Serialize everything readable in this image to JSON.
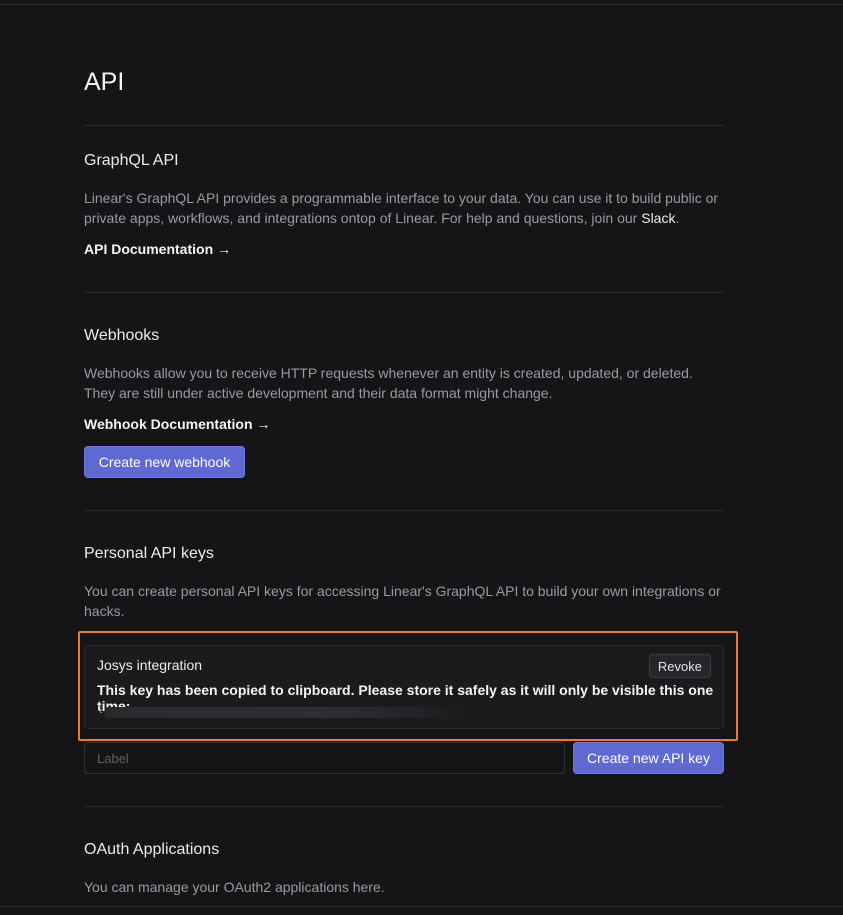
{
  "page": {
    "title": "API"
  },
  "graphql": {
    "title": "GraphQL API",
    "description_before": "Linear's GraphQL API provides a programmable interface to your data. You can use it to build public or private apps, workflows, and integrations ontop of Linear. For help and questions, join our ",
    "description_link": "Slack",
    "description_after": ".",
    "doc_link": "API Documentation",
    "arrow": "→"
  },
  "webhooks": {
    "title": "Webhooks",
    "description": "Webhooks allow you to receive HTTP requests whenever an entity is created, updated, or deleted. They are still under active development and their data format might change.",
    "doc_link": "Webhook Documentation",
    "arrow": "→",
    "create_button": "Create new webhook"
  },
  "personal_keys": {
    "title": "Personal API keys",
    "description": "You can create personal API keys for accessing Linear's GraphQL API to build your own integrations or hacks.",
    "key": {
      "name": "Josys integration",
      "revoke_label": "Revoke",
      "notice": "This key has been copied to clipboard. Please store it safely as it will only be visible this one time:",
      "value_prefix": "l"
    },
    "label_placeholder": "Label",
    "create_button": "Create new API key"
  },
  "oauth": {
    "title": "OAuth Applications",
    "description": "You can manage your OAuth2 applications here."
  },
  "colors": {
    "background": "#151517",
    "accent": "#5e6ad2",
    "highlight": "#f0782a"
  }
}
